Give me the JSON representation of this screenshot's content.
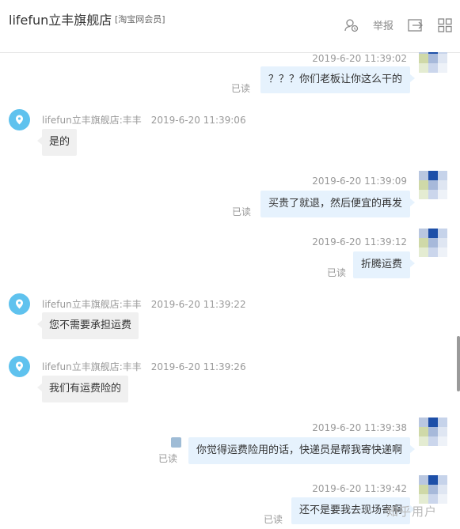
{
  "header": {
    "shop_name": "lifefun立丰旗舰店",
    "member_label": "[淘宝网会员]",
    "report_label": "举报",
    "icons": [
      "user-shield-icon",
      "export-icon",
      "apps-grid-icon"
    ]
  },
  "messages": [
    {
      "side": "right",
      "time": "2019-6-20 11:39:02",
      "text": "？？？你们老板让你这么干的",
      "status": "已读"
    },
    {
      "side": "left",
      "sender": "lifefun立丰旗舰店:丰丰",
      "time": "2019-6-20 11:39:06",
      "text": "是的"
    },
    {
      "side": "right",
      "time": "2019-6-20 11:39:09",
      "text": "买贵了就退，然后便宜的再发",
      "status": "已读"
    },
    {
      "side": "right",
      "time": "2019-6-20 11:39:12",
      "text": "折腾运费",
      "status": "已读"
    },
    {
      "side": "left",
      "sender": "lifefun立丰旗舰店:丰丰",
      "time": "2019-6-20 11:39:22",
      "text": "您不需要承担运费"
    },
    {
      "side": "left",
      "sender": "lifefun立丰旗舰店:丰丰",
      "time": "2019-6-20 11:39:26",
      "text": "我们有运费险的"
    },
    {
      "side": "right",
      "time": "2019-6-20 11:39:38",
      "text": "你觉得运费险用的话，快递员是帮我寄快递啊",
      "status": "已读"
    },
    {
      "side": "right",
      "time": "2019-6-20 11:39:42",
      "text": "还不是要我去现场寄啊",
      "status": "已读"
    }
  ],
  "watermark": "知乎用户",
  "colors": {
    "right_bubble": "#e6f2fd",
    "left_bubble": "#f0f0f0",
    "seller_avatar": "#5fc2ee",
    "timestamp": "#999999"
  }
}
